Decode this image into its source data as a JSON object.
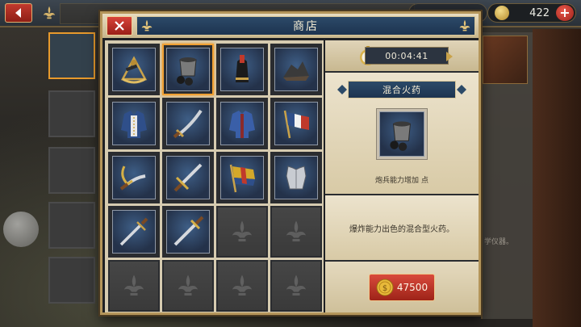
{
  "background": {
    "gem_count": "422",
    "plus_label": "+",
    "side_note": "学仪器。"
  },
  "shop": {
    "title": "商店",
    "close_label": "✕",
    "timer": "00:04:41",
    "selected_item": {
      "name": "混合火药",
      "bonus_prefix": "炮兵能力增加",
      "bonus_value": "",
      "bonus_suffix": "点",
      "description": "爆炸能力出色的混合型火药。",
      "price": "47500"
    },
    "items": [
      {
        "icon": "sextant-icon"
      },
      {
        "icon": "gunpowder-bucket-icon",
        "selected": true
      },
      {
        "icon": "shako-hat-icon"
      },
      {
        "icon": "ore-pile-icon"
      },
      {
        "icon": "uniform-coat-icon"
      },
      {
        "icon": "saber-icon"
      },
      {
        "icon": "jacket-icon"
      },
      {
        "icon": "tricolor-flag-icon"
      },
      {
        "icon": "curved-sword-icon"
      },
      {
        "icon": "sword-icon"
      },
      {
        "icon": "battle-flag-icon"
      },
      {
        "icon": "cuirass-icon"
      },
      {
        "icon": "dagger-icon"
      },
      {
        "icon": "long-sword-icon"
      },
      {
        "icon": "empty-slot"
      },
      {
        "icon": "empty-slot"
      },
      {
        "icon": "empty-slot"
      },
      {
        "icon": "empty-slot"
      },
      {
        "icon": "empty-slot"
      },
      {
        "icon": "empty-slot"
      }
    ]
  },
  "colors": {
    "accent_red": "#c23a2e",
    "title_blue": "#2c4a68",
    "selection_orange": "#f0a033",
    "parchment": "#e6dcc2",
    "bonus_green": "#3fae3a"
  }
}
